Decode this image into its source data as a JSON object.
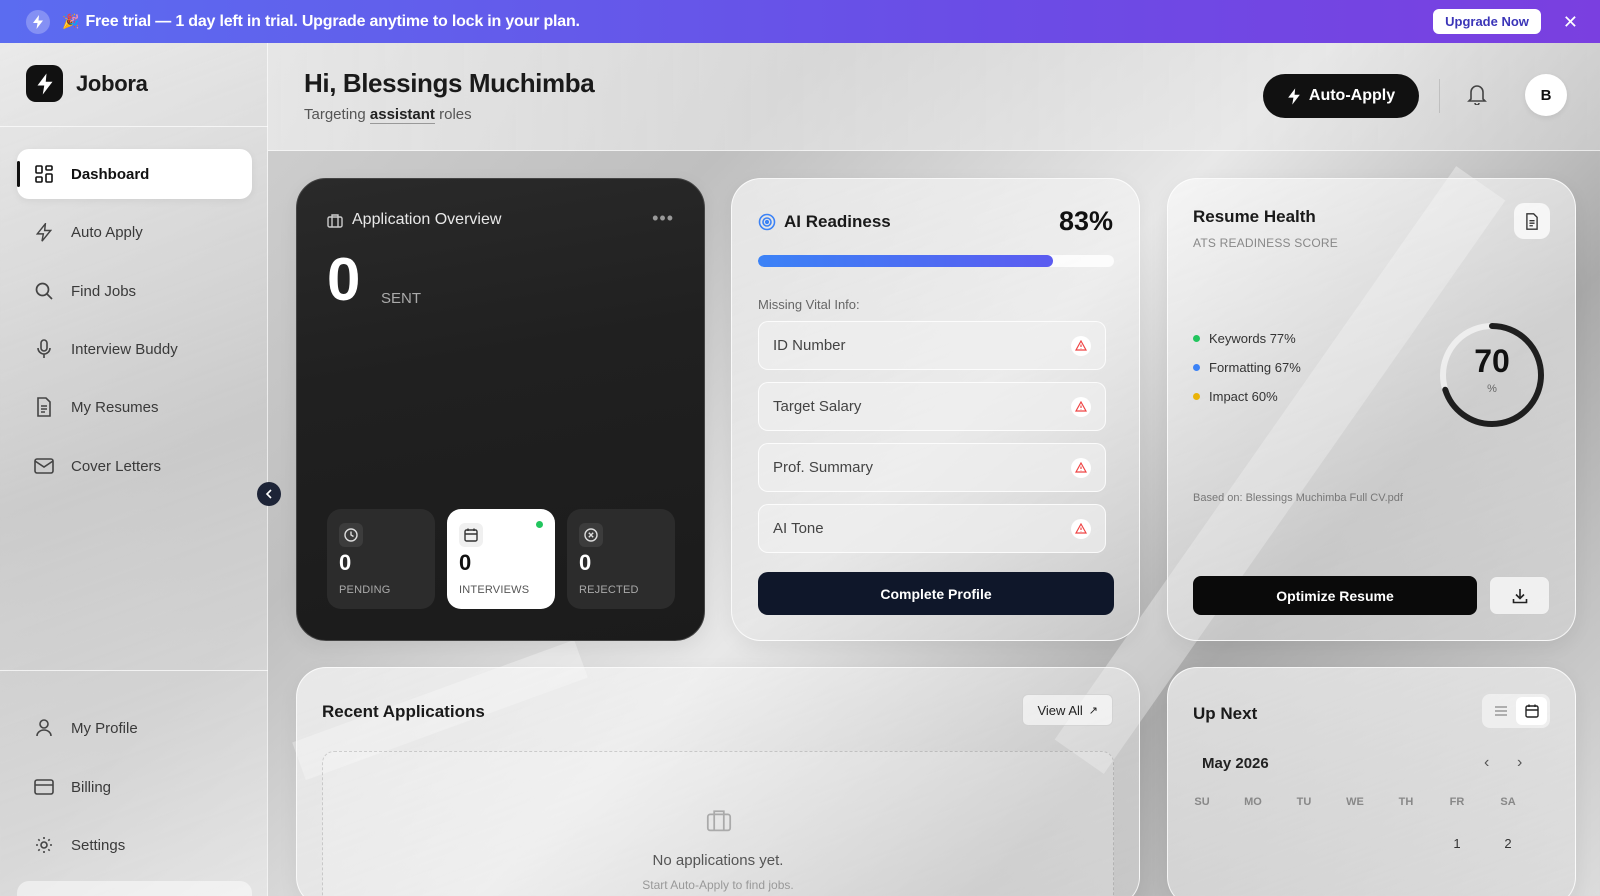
{
  "banner": {
    "party": "🎉",
    "message": "Free trial — 1 day left in trial. Upgrade anytime to lock in your plan.",
    "upgrade_label": "Upgrade Now",
    "close": "✕"
  },
  "brand": {
    "name": "Jobora"
  },
  "sidebar": {
    "items": [
      {
        "label": "Dashboard",
        "icon": "grid-icon",
        "active": true
      },
      {
        "label": "Auto Apply",
        "icon": "bolt-icon"
      },
      {
        "label": "Find Jobs",
        "icon": "search-icon"
      },
      {
        "label": "Interview Buddy",
        "icon": "mic-icon"
      },
      {
        "label": "My Resumes",
        "icon": "document-icon"
      },
      {
        "label": "Cover Letters",
        "icon": "mail-icon"
      }
    ],
    "bottom_items": [
      {
        "label": "My Profile",
        "icon": "user-icon"
      },
      {
        "label": "Billing",
        "icon": "card-icon"
      },
      {
        "label": "Settings",
        "icon": "gear-icon"
      }
    ]
  },
  "header": {
    "greeting": "Hi, Blessings Muchimba",
    "sub_prefix": "Targeting",
    "sub_role": "assistant",
    "sub_suffix": "roles",
    "auto_apply_label": "Auto-Apply",
    "avatar_initial": "B"
  },
  "overview": {
    "title": "Application Overview",
    "more": "•••",
    "count": "0",
    "count_label": "SENT",
    "stats": [
      {
        "value": "0",
        "label": "PENDING",
        "icon": "clock-icon"
      },
      {
        "value": "0",
        "label": "INTERVIEWS",
        "icon": "calendar-icon"
      },
      {
        "value": "0",
        "label": "REJECTED",
        "icon": "x-circle-icon"
      }
    ]
  },
  "readiness": {
    "title": "AI Readiness",
    "percent_text": "83%",
    "percent": 83,
    "missing_label": "Missing Vital Info:",
    "missing": [
      "ID Number",
      "Target Salary",
      "Prof. Summary",
      "AI Tone"
    ],
    "cta": "Complete Profile"
  },
  "health": {
    "title": "Resume Health",
    "subtitle": "ATS READINESS SCORE",
    "metrics": [
      {
        "label": "Keywords 77%",
        "color": "#22c55e"
      },
      {
        "label": "Formatting 67%",
        "color": "#3b82f6"
      },
      {
        "label": "Impact 60%",
        "color": "#eab308"
      }
    ],
    "score": "70",
    "score_value": 70,
    "score_unit": "%",
    "based_on": "Based on: Blessings Muchimba Full CV.pdf",
    "cta": "Optimize Resume"
  },
  "recent": {
    "title": "Recent Applications",
    "view_all": "View All",
    "view_all_arrow": "↗",
    "empty_title": "No applications yet.",
    "empty_sub": "Start Auto-Apply to find jobs."
  },
  "upnext": {
    "title": "Up Next",
    "month": "May 2026",
    "prev": "‹",
    "next": "›",
    "weekdays": [
      "SU",
      "MO",
      "TU",
      "WE",
      "TH",
      "FR",
      "SA"
    ],
    "days": [
      "1",
      "2"
    ]
  }
}
